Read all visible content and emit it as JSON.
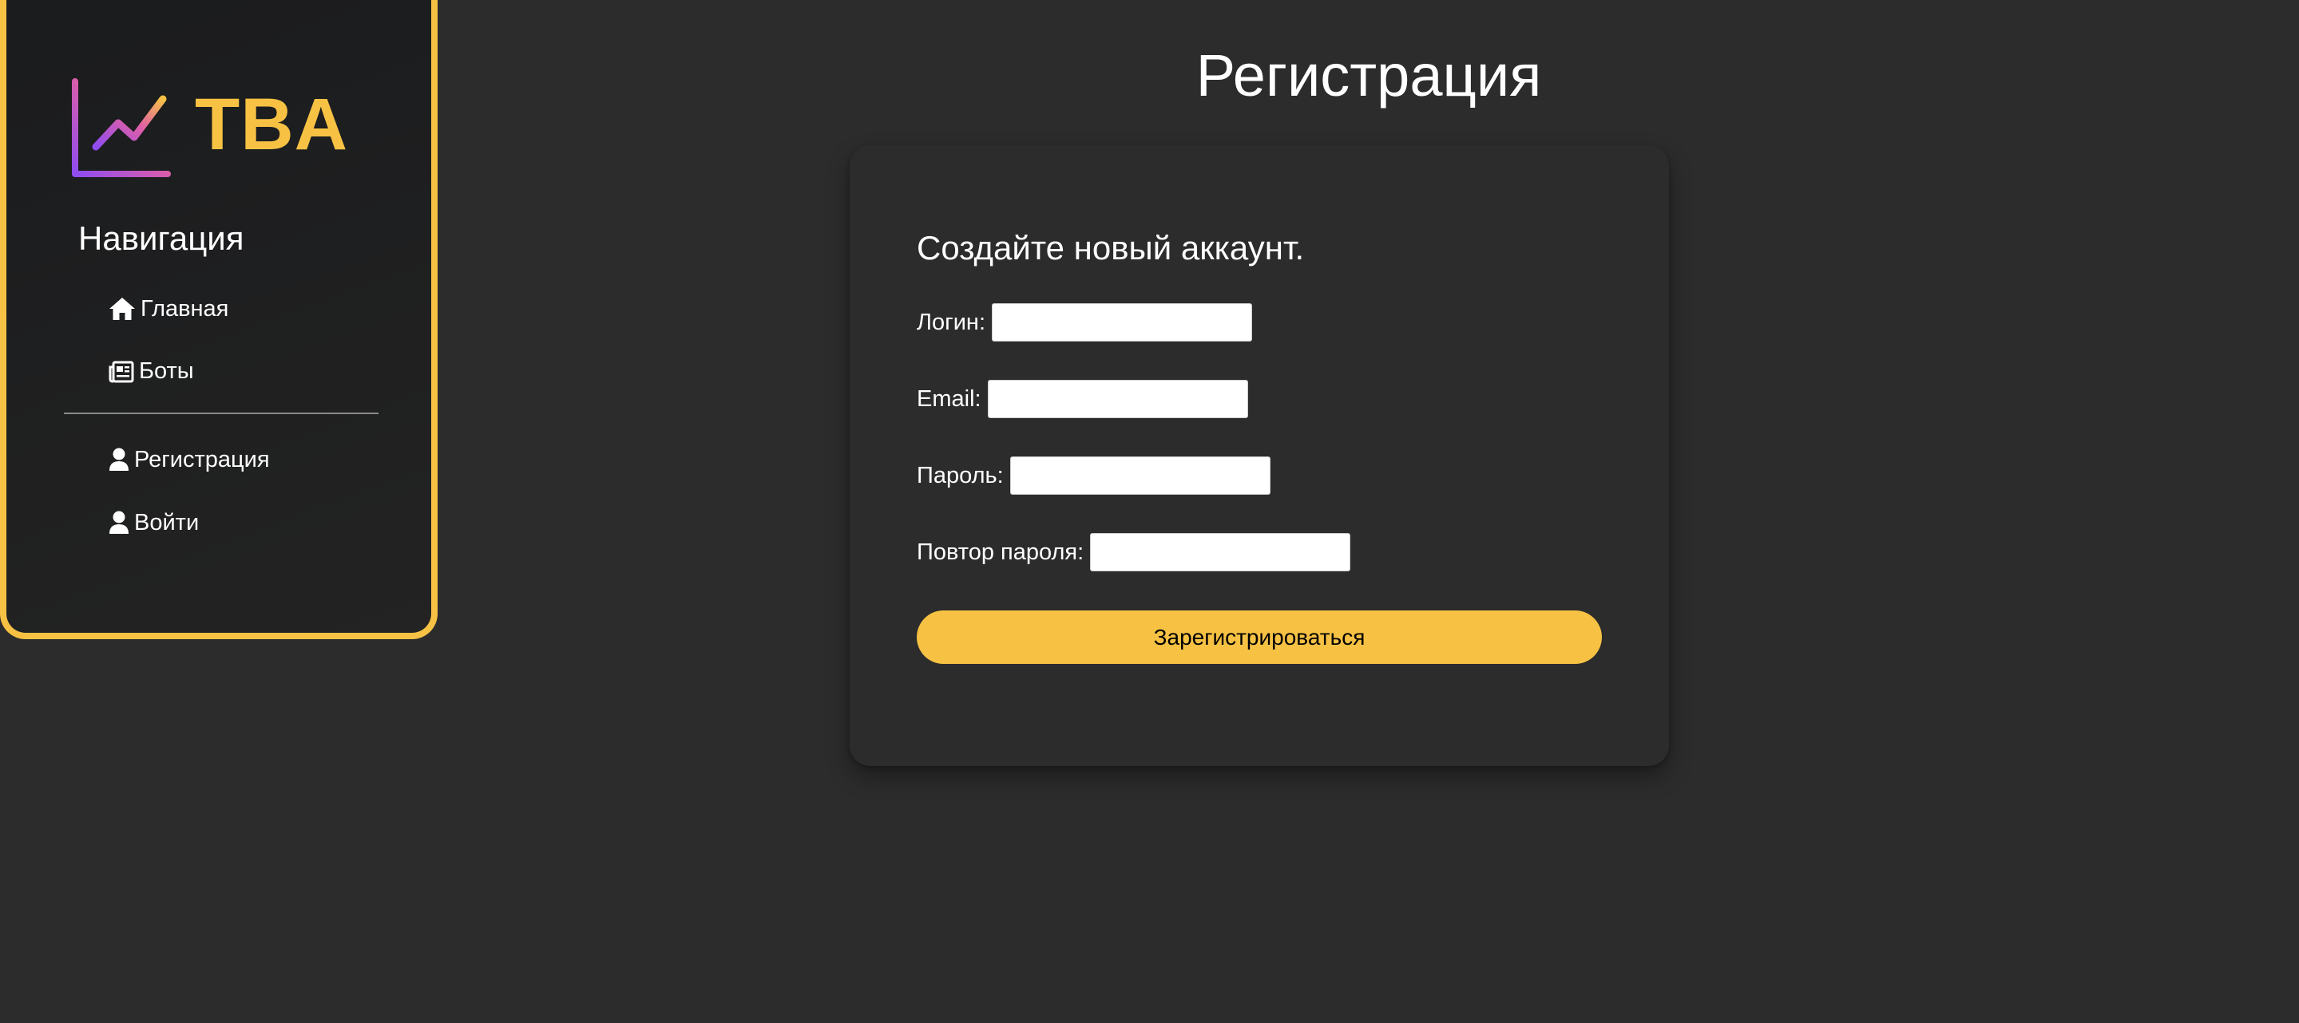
{
  "brand": {
    "name": "TBA",
    "icon": "chart-line-icon",
    "accent_color": "#f7c244"
  },
  "sidebar": {
    "title": "Навигация",
    "items": [
      {
        "label": "Главная",
        "icon": "home-icon"
      },
      {
        "label": "Боты",
        "icon": "newspaper-icon"
      },
      {
        "label": "Регистрация",
        "icon": "user-icon"
      },
      {
        "label": "Войти",
        "icon": "user-icon"
      }
    ]
  },
  "page": {
    "title": "Регистрация"
  },
  "form": {
    "heading": "Создайте новый аккаунт.",
    "fields": [
      {
        "label": "Логин:",
        "value": ""
      },
      {
        "label": "Email:",
        "value": ""
      },
      {
        "label": "Пароль:",
        "value": ""
      },
      {
        "label": "Повтор пароля:",
        "value": ""
      }
    ],
    "submit_label": "Зарегистрироваться"
  },
  "colors": {
    "background": "#2c2c2c",
    "sidebar_border": "#f7c244",
    "button": "#f7c244"
  }
}
